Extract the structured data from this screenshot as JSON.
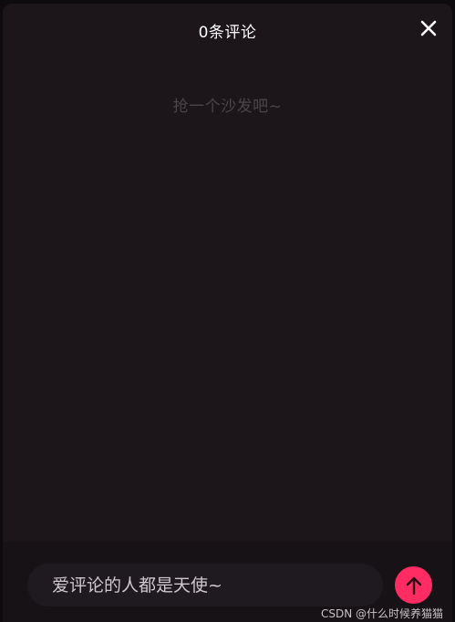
{
  "header": {
    "title": "0条评论",
    "close_icon": "close-icon"
  },
  "comments": {
    "empty_text": "抢一个沙发吧~"
  },
  "composer": {
    "placeholder": "爱评论的人都是天使~",
    "value": "",
    "send_icon": "arrow-up-icon",
    "send_color": "#fe2c63"
  },
  "watermark": {
    "text": "CSDN @什么时候养猫猫"
  },
  "colors": {
    "panel_bg": "#1c161b",
    "accent": "#fe2c63"
  }
}
